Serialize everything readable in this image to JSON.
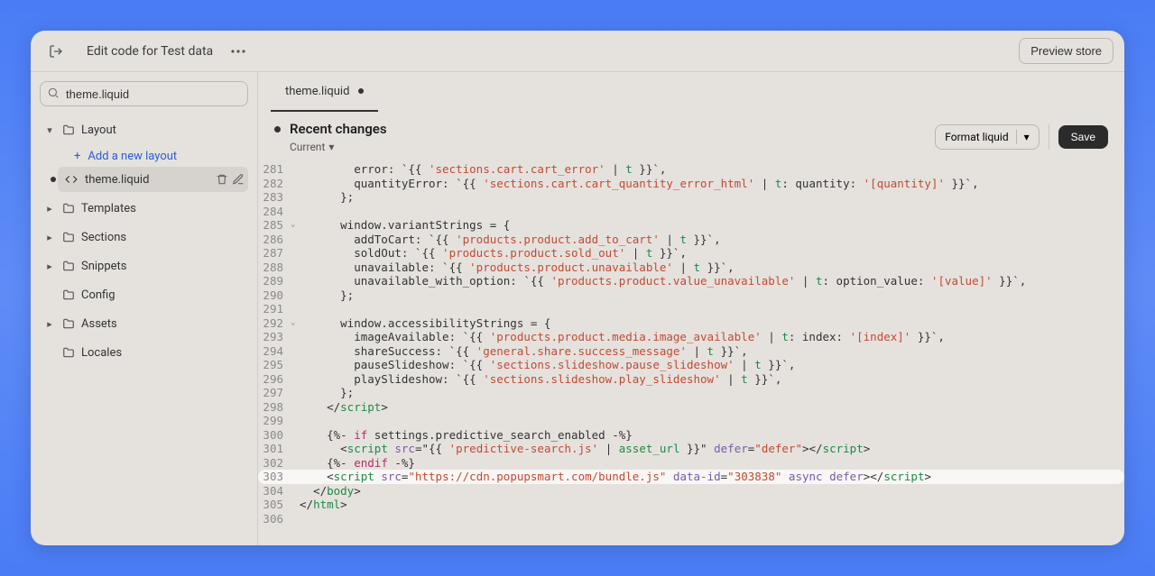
{
  "topbar": {
    "title": "Edit code for Test data",
    "preview_label": "Preview store"
  },
  "sidebar": {
    "search_value": "theme.liquid",
    "layout_label": "Layout",
    "add_layout_label": "Add a new layout",
    "active_file": "theme.liquid",
    "folders": {
      "templates": "Templates",
      "sections": "Sections",
      "snippets": "Snippets",
      "config": "Config",
      "assets": "Assets",
      "locales": "Locales"
    }
  },
  "editor": {
    "tab_label": "theme.liquid",
    "recent_label": "Recent changes",
    "current_label": "Current",
    "format_label": "Format liquid",
    "save_label": "Save"
  },
  "code": {
    "lines": [
      {
        "n": 281,
        "seg": [
          {
            "t": "        error: `{{ "
          },
          {
            "t": "'sections.cart.cart_error'",
            "c": "s-str"
          },
          {
            "t": " | "
          },
          {
            "t": "t",
            "c": "s-t"
          },
          {
            "t": " }}`,"
          }
        ]
      },
      {
        "n": 282,
        "seg": [
          {
            "t": "        quantityError: `{{ "
          },
          {
            "t": "'sections.cart.cart_quantity_error_html'",
            "c": "s-str"
          },
          {
            "t": " | "
          },
          {
            "t": "t",
            "c": "s-t"
          },
          {
            "t": ": quantity: "
          },
          {
            "t": "'[quantity]'",
            "c": "s-str"
          },
          {
            "t": " }}`,"
          }
        ]
      },
      {
        "n": 283,
        "seg": [
          {
            "t": "      };"
          }
        ]
      },
      {
        "n": 284,
        "seg": [
          {
            "t": ""
          }
        ]
      },
      {
        "n": 285,
        "fold": true,
        "seg": [
          {
            "t": "      window.variantStrings = {"
          }
        ]
      },
      {
        "n": 286,
        "seg": [
          {
            "t": "        addToCart: `{{ "
          },
          {
            "t": "'products.product.add_to_cart'",
            "c": "s-str"
          },
          {
            "t": " | "
          },
          {
            "t": "t",
            "c": "s-t"
          },
          {
            "t": " }}`,"
          }
        ]
      },
      {
        "n": 287,
        "seg": [
          {
            "t": "        soldOut: `{{ "
          },
          {
            "t": "'products.product.sold_out'",
            "c": "s-str"
          },
          {
            "t": " | "
          },
          {
            "t": "t",
            "c": "s-t"
          },
          {
            "t": " }}`,"
          }
        ]
      },
      {
        "n": 288,
        "seg": [
          {
            "t": "        unavailable: `{{ "
          },
          {
            "t": "'products.product.unavailable'",
            "c": "s-str"
          },
          {
            "t": " | "
          },
          {
            "t": "t",
            "c": "s-t"
          },
          {
            "t": " }}`,"
          }
        ]
      },
      {
        "n": 289,
        "seg": [
          {
            "t": "        unavailable_with_option: `{{ "
          },
          {
            "t": "'products.product.value_unavailable'",
            "c": "s-str"
          },
          {
            "t": " | "
          },
          {
            "t": "t",
            "c": "s-t"
          },
          {
            "t": ": option_value: "
          },
          {
            "t": "'[value]'",
            "c": "s-str"
          },
          {
            "t": " }}`,"
          }
        ]
      },
      {
        "n": 290,
        "seg": [
          {
            "t": "      };"
          }
        ]
      },
      {
        "n": 291,
        "seg": [
          {
            "t": ""
          }
        ]
      },
      {
        "n": 292,
        "fold": true,
        "seg": [
          {
            "t": "      window.accessibilityStrings = {"
          }
        ]
      },
      {
        "n": 293,
        "seg": [
          {
            "t": "        imageAvailable: `{{ "
          },
          {
            "t": "'products.product.media.image_available'",
            "c": "s-str"
          },
          {
            "t": " | "
          },
          {
            "t": "t",
            "c": "s-t"
          },
          {
            "t": ": index: "
          },
          {
            "t": "'[index]'",
            "c": "s-str"
          },
          {
            "t": " }}`,"
          }
        ]
      },
      {
        "n": 294,
        "seg": [
          {
            "t": "        shareSuccess: `{{ "
          },
          {
            "t": "'general.share.success_message'",
            "c": "s-str"
          },
          {
            "t": " | "
          },
          {
            "t": "t",
            "c": "s-t"
          },
          {
            "t": " }}`,"
          }
        ]
      },
      {
        "n": 295,
        "seg": [
          {
            "t": "        pauseSlideshow: `{{ "
          },
          {
            "t": "'sections.slideshow.pause_slideshow'",
            "c": "s-str"
          },
          {
            "t": " | "
          },
          {
            "t": "t",
            "c": "s-t"
          },
          {
            "t": " }}`,"
          }
        ]
      },
      {
        "n": 296,
        "seg": [
          {
            "t": "        playSlideshow: `{{ "
          },
          {
            "t": "'sections.slideshow.play_slideshow'",
            "c": "s-str"
          },
          {
            "t": " | "
          },
          {
            "t": "t",
            "c": "s-t"
          },
          {
            "t": " }}`,"
          }
        ]
      },
      {
        "n": 297,
        "seg": [
          {
            "t": "      };"
          }
        ]
      },
      {
        "n": 298,
        "seg": [
          {
            "t": "    </"
          },
          {
            "t": "script",
            "c": "s-tag"
          },
          {
            "t": ">"
          }
        ]
      },
      {
        "n": 299,
        "seg": [
          {
            "t": ""
          }
        ]
      },
      {
        "n": 300,
        "seg": [
          {
            "t": "    {%- "
          },
          {
            "t": "if",
            "c": "s-kw"
          },
          {
            "t": " settings.predictive_search_enabled -%}"
          }
        ]
      },
      {
        "n": 301,
        "seg": [
          {
            "t": "      <"
          },
          {
            "t": "script",
            "c": "s-tag"
          },
          {
            "t": " "
          },
          {
            "t": "src",
            "c": "s-attr"
          },
          {
            "t": "=\"{{ "
          },
          {
            "t": "'predictive-search.js'",
            "c": "s-str"
          },
          {
            "t": " | "
          },
          {
            "t": "asset_url",
            "c": "s-t"
          },
          {
            "t": " }}\" "
          },
          {
            "t": "defer",
            "c": "s-attr"
          },
          {
            "t": "="
          },
          {
            "t": "\"defer\"",
            "c": "s-str"
          },
          {
            "t": "></"
          },
          {
            "t": "script",
            "c": "s-tag"
          },
          {
            "t": ">"
          }
        ]
      },
      {
        "n": 302,
        "seg": [
          {
            "t": "    {%- "
          },
          {
            "t": "endif",
            "c": "s-kw"
          },
          {
            "t": " -%}"
          }
        ]
      },
      {
        "n": 303,
        "hl": true,
        "seg": [
          {
            "t": "    <"
          },
          {
            "t": "script",
            "c": "s-tag"
          },
          {
            "t": " "
          },
          {
            "t": "src",
            "c": "s-attr"
          },
          {
            "t": "="
          },
          {
            "t": "\"https://cdn.popupsmart.com/bundle.js\"",
            "c": "s-str"
          },
          {
            "t": " "
          },
          {
            "t": "data-id",
            "c": "s-attr"
          },
          {
            "t": "="
          },
          {
            "t": "\"303838\"",
            "c": "s-str"
          },
          {
            "t": " "
          },
          {
            "t": "async",
            "c": "s-attr"
          },
          {
            "t": " "
          },
          {
            "t": "defer",
            "c": "s-attr"
          },
          {
            "t": "></"
          },
          {
            "t": "script",
            "c": "s-tag"
          },
          {
            "t": ">"
          }
        ]
      },
      {
        "n": 304,
        "seg": [
          {
            "t": "  </"
          },
          {
            "t": "body",
            "c": "s-tag"
          },
          {
            "t": ">"
          }
        ]
      },
      {
        "n": 305,
        "seg": [
          {
            "t": "</"
          },
          {
            "t": "html",
            "c": "s-tag"
          },
          {
            "t": ">"
          }
        ]
      },
      {
        "n": 306,
        "seg": [
          {
            "t": ""
          }
        ]
      }
    ]
  }
}
